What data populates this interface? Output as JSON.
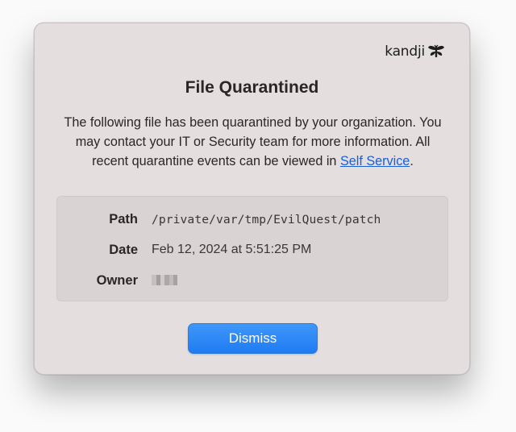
{
  "dialog": {
    "brand": "kandji",
    "title": "File Quarantined",
    "message_prefix": "The following file has been quarantined by your organization. You may contact your IT or Security team for more information. All recent quarantine events can be viewed in ",
    "message_link": "Self Service",
    "message_suffix": ".",
    "details": [
      {
        "label": "Path",
        "value": "/private/var/tmp/EvilQuest/patch"
      },
      {
        "label": "Date",
        "value": "Feb 12, 2024 at 5:51:25 PM"
      },
      {
        "label": "Owner",
        "value": ""
      }
    ],
    "dismiss_label": "Dismiss"
  },
  "colors": {
    "dialog_bg": "#e5dedf",
    "details_bg": "#dad3d4",
    "link": "#1b5fd1",
    "button": "#1f7bf2"
  },
  "icons": {
    "brand_logo": "bee-icon",
    "owner_value": "redacted-pixelated"
  }
}
